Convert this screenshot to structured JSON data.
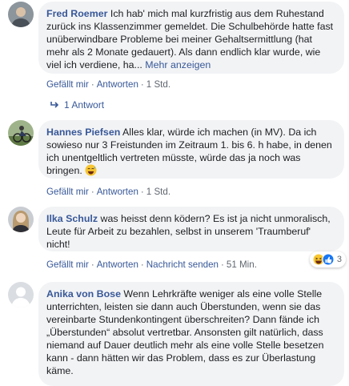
{
  "comments": [
    {
      "author": "Fred Roemer",
      "text": "Ich hab' mich mal kurzfristig aus dem Ruhestand zurück ins Klassenzimmer gemeldet. Die Schulbehörde hatte fast unüberwindbare Probleme bei meiner Gehaltsermittlung (hat mehr als 2 Monate gedauert). Als dann endlich klar wurde, wie viel ich verdiene, ha...",
      "more": "Mehr anzeigen",
      "like": "Gefällt mir",
      "reply": "Antworten",
      "time": "1 Std.",
      "reply_count": "1 Antwort"
    },
    {
      "author": "Hannes Piefsen",
      "text": "Alles klar, würde ich machen (in MV). Da ich sowieso nur 3 Freistunden im Zeitraum 1. bis 6. h habe, in denen ich unentgeltlich vertreten müsste, würde das ja noch was bringen.",
      "emoji": "😅",
      "like": "Gefällt mir",
      "reply": "Antworten",
      "time": "1 Std."
    },
    {
      "author": "Ilka Schulz",
      "text": "was heisst denn ködern? Es ist ja nicht unmoralisch, Leute für Arbeit zu bezahlen, selbst in unserem 'Traumberuf' nicht!",
      "like": "Gefällt mir",
      "reply": "Antworten",
      "message": "Nachricht senden",
      "time": "51 Min.",
      "reaction_count": "3"
    },
    {
      "author": "Anika von Bose",
      "text": "Wenn Lehrkräfte weniger als eine volle Stelle unterrichten, leisten sie dann auch Überstunden, wenn sie das vereinbarte Stundenkontingent überschreiten? Dann fände ich „Überstunden“ absolut vertretbar. Ansonsten gilt natürlich, dass niemand auf Dauer deutlich mehr als eine volle Stelle besetzen kann - dann hätten wir das Problem, dass es zur Überlastung käme."
    }
  ],
  "separator": "·",
  "colors": {
    "link": "#385898",
    "bubble": "#f2f3f5",
    "meta": "#606770"
  }
}
